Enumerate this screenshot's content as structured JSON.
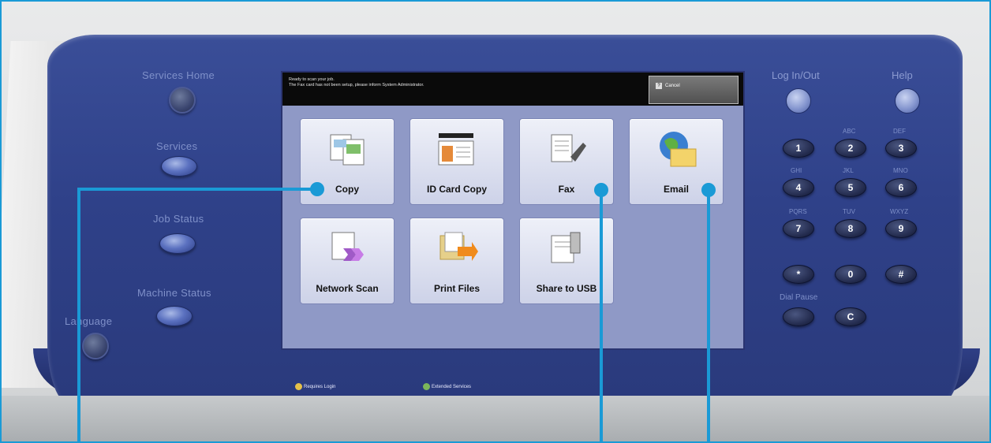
{
  "left_panel": {
    "buttons": [
      {
        "label": "Services Home"
      },
      {
        "label": "Services"
      },
      {
        "label": "Job Status"
      },
      {
        "label": "Machine Status"
      },
      {
        "label": "Language"
      }
    ]
  },
  "screen": {
    "message": "Ready to scan your job.\nThe Fax card has not been setup, please inform System Administrator.",
    "cancel_label": "Cancel",
    "tiles": [
      {
        "label": "Copy",
        "icon": "copy-icon"
      },
      {
        "label": "ID Card Copy",
        "icon": "id-card-copy-icon"
      },
      {
        "label": "Fax",
        "icon": "fax-icon"
      },
      {
        "label": "Email",
        "icon": "email-icon"
      },
      {
        "label": "Network Scan",
        "icon": "network-scan-icon"
      },
      {
        "label": "Print Files",
        "icon": "print-files-icon"
      },
      {
        "label": "Share to USB",
        "icon": "share-to-usb-icon"
      }
    ],
    "footer": [
      {
        "label": "Requires Login"
      },
      {
        "label": "Extended Services"
      }
    ]
  },
  "keypad": {
    "log_in_out": "Log In/Out",
    "help": "Help",
    "dial_pause": "Dial Pause",
    "letters": [
      "ABC",
      "DEF",
      "GHI",
      "JKL",
      "MNO",
      "PQRS",
      "TUV",
      "WXYZ"
    ],
    "keys": [
      "1",
      "2",
      "3",
      "4",
      "5",
      "6",
      "7",
      "8",
      "9",
      "*",
      "0",
      "#",
      "C"
    ]
  },
  "colors": {
    "callout": "#1a9ad6",
    "console": "#2f4189",
    "screen_bg": "#8f99c6"
  }
}
